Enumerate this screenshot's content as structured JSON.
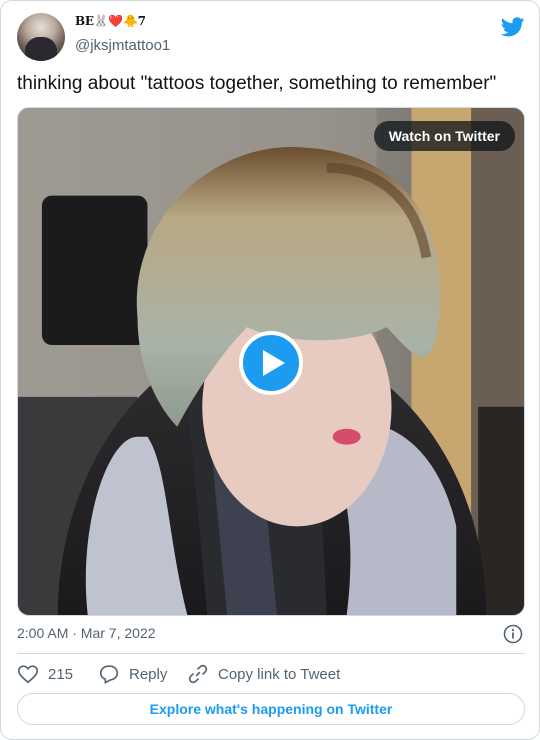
{
  "author": {
    "display_name": "BE🐰❤️🐥7",
    "handle": "@jksjmtattoo1"
  },
  "tweet": {
    "text": "thinking about \"tattoos together, something to remember\"",
    "timestamp": "2:00 AM · Mar 7, 2022"
  },
  "media": {
    "watch_label": "Watch on Twitter"
  },
  "actions": {
    "like_count": "215",
    "reply_label": "Reply",
    "copy_label": "Copy link to Tweet"
  },
  "explore_label": "Explore what's happening on Twitter",
  "colors": {
    "accent": "#1d9bf0",
    "text_primary": "#0f1419",
    "text_secondary": "#536471",
    "border": "#cfd9de"
  },
  "icons": [
    "twitter-bird-icon",
    "play-icon",
    "info-icon",
    "heart-icon",
    "reply-icon",
    "link-icon"
  ]
}
